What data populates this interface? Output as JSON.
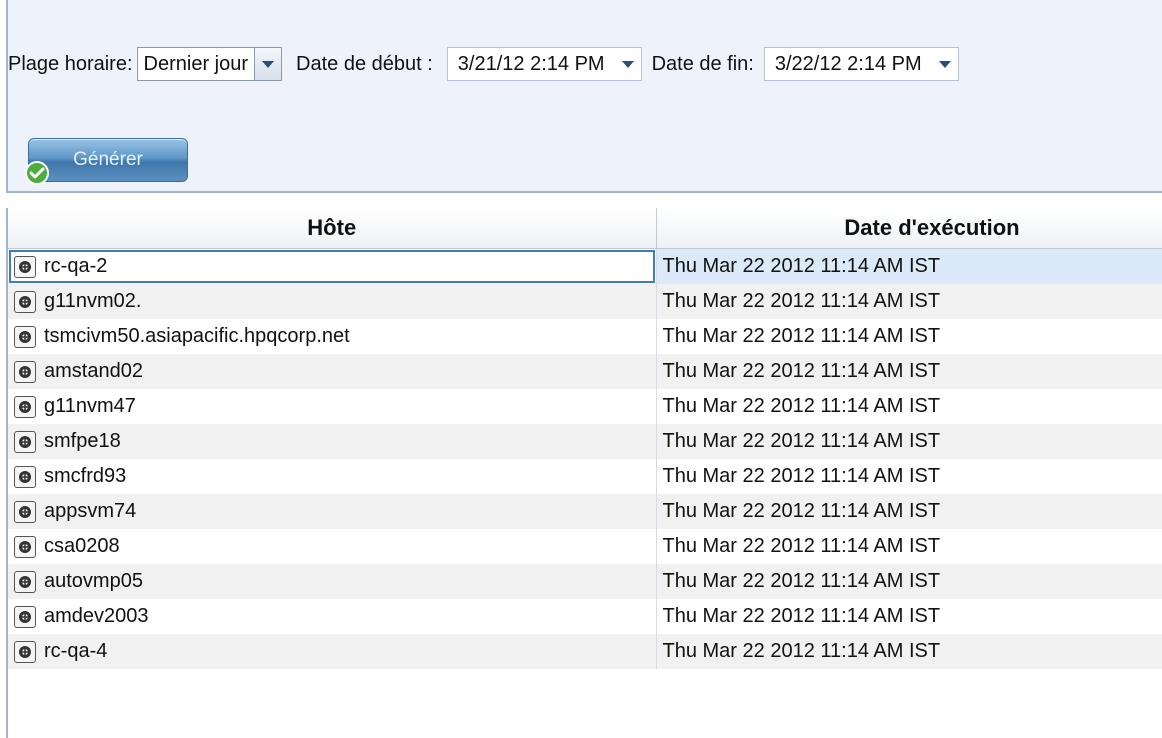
{
  "filters": {
    "range_label": "Plage horaire:",
    "range_value": "Dernier jour",
    "start_label": "Date de début :",
    "start_value": "3/21/12 2:14 PM",
    "end_label": "Date de fin:",
    "end_value": "3/22/12 2:14 PM"
  },
  "generate_button": {
    "label": "Générer",
    "icon": "check-circle-icon"
  },
  "table": {
    "columns": [
      "Hôte",
      "Date d'exécution"
    ],
    "rows": [
      {
        "host": "rc-qa-2",
        "date": "Thu Mar 22 2012 11:14 AM IST"
      },
      {
        "host": "g11nvm02.",
        "date": "Thu Mar 22 2012 11:14 AM IST"
      },
      {
        "host": "tsmcivm50.asiapacific.hpqcorp.net",
        "date": "Thu Mar 22 2012 11:14 AM IST"
      },
      {
        "host": "amstand02",
        "date": "Thu Mar 22 2012 11:14 AM IST"
      },
      {
        "host": "g11nvm47",
        "date": "Thu Mar 22 2012 11:14 AM IST"
      },
      {
        "host": "smfpe18",
        "date": "Thu Mar 22 2012 11:14 AM IST"
      },
      {
        "host": "smcfrd93",
        "date": "Thu Mar 22 2012 11:14 AM IST"
      },
      {
        "host": "appsvm74",
        "date": "Thu Mar 22 2012 11:14 AM IST"
      },
      {
        "host": "csa0208",
        "date": "Thu Mar 22 2012 11:14 AM IST"
      },
      {
        "host": "autovmp05",
        "date": "Thu Mar 22 2012 11:14 AM IST"
      },
      {
        "host": "amdev2003",
        "date": "Thu Mar 22 2012 11:14 AM IST"
      },
      {
        "host": "rc-qa-4",
        "date": "Thu Mar 22 2012 11:14 AM IST"
      }
    ],
    "row_icon": "host-node-icon",
    "selected_row": 0
  },
  "colors": {
    "panel_bg": "#eef3fb",
    "button_blue": "#5f97c7",
    "selection_outline": "#3f7bbd",
    "selection_fill": "#dbe9f8"
  }
}
